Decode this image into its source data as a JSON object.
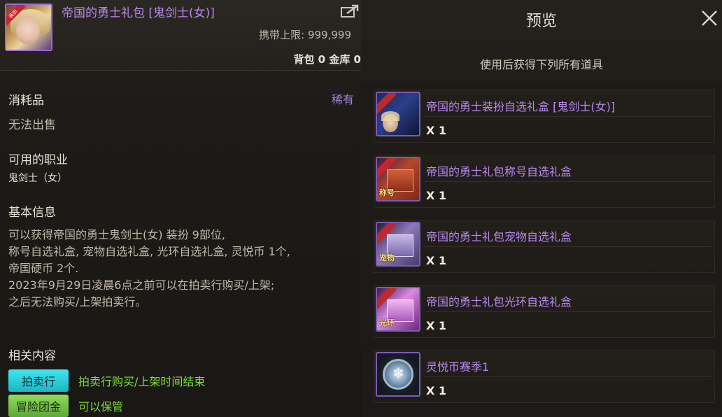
{
  "left": {
    "item_title": "帝国的勇士礼包 [鬼剑士(女)]",
    "carry_limit_label": "携带上限:",
    "carry_limit_value": "999,999",
    "storage_line": "背包 0 金库 0",
    "category": "消耗品",
    "rarity": "稀有",
    "sell_status": "无法出售",
    "job_title": "可用的职业",
    "job_value": "鬼剑士（女）",
    "basic_info_title": "基本信息",
    "basic_info_lines": [
      "可以获得帝国的勇士鬼剑士(女) 装扮 9部位,",
      "称号自选礼盒, 宠物自选礼盒, 光环自选礼盒, 灵悦币 1个,",
      "帝国硬币 2个.",
      "2023年9月29日凌晨6点之前可以在拍卖行购买/上架;",
      "之后无法购买/上架拍卖行。"
    ],
    "related_title": "相关内容",
    "related": [
      {
        "tag": "拍卖行",
        "text": "拍卖行购买/上架时间结束"
      },
      {
        "tag": "冒险团金",
        "text": "可以保管"
      }
    ],
    "icon_ribbon": "装扮"
  },
  "right": {
    "title": "预览",
    "subtitle": "使用后获得下列所有道具",
    "rewards": [
      {
        "name": "帝国的勇士装扮自选礼盒 [鬼剑士(女)]",
        "qty": "X 1",
        "icon_label": ""
      },
      {
        "name": "帝国的勇士礼包称号自选礼盒",
        "qty": "X 1",
        "icon_label": "称号"
      },
      {
        "name": "帝国的勇士礼包宠物自选礼盒",
        "qty": "X 1",
        "icon_label": "宠物"
      },
      {
        "name": "帝国的勇士礼包光环自选礼盒",
        "qty": "X 1",
        "icon_label": "光环"
      },
      {
        "name": "灵悦币赛季1",
        "qty": "X 1",
        "icon_label": ""
      }
    ]
  },
  "colors": {
    "item_name": "#b889f0",
    "rarity": "#a67ee6",
    "related_text": "#7fdc3c",
    "auction_tag": "#2fd0dc",
    "guild_tag": "#79c64a"
  },
  "icons": [
    "share-icon",
    "close-icon"
  ]
}
